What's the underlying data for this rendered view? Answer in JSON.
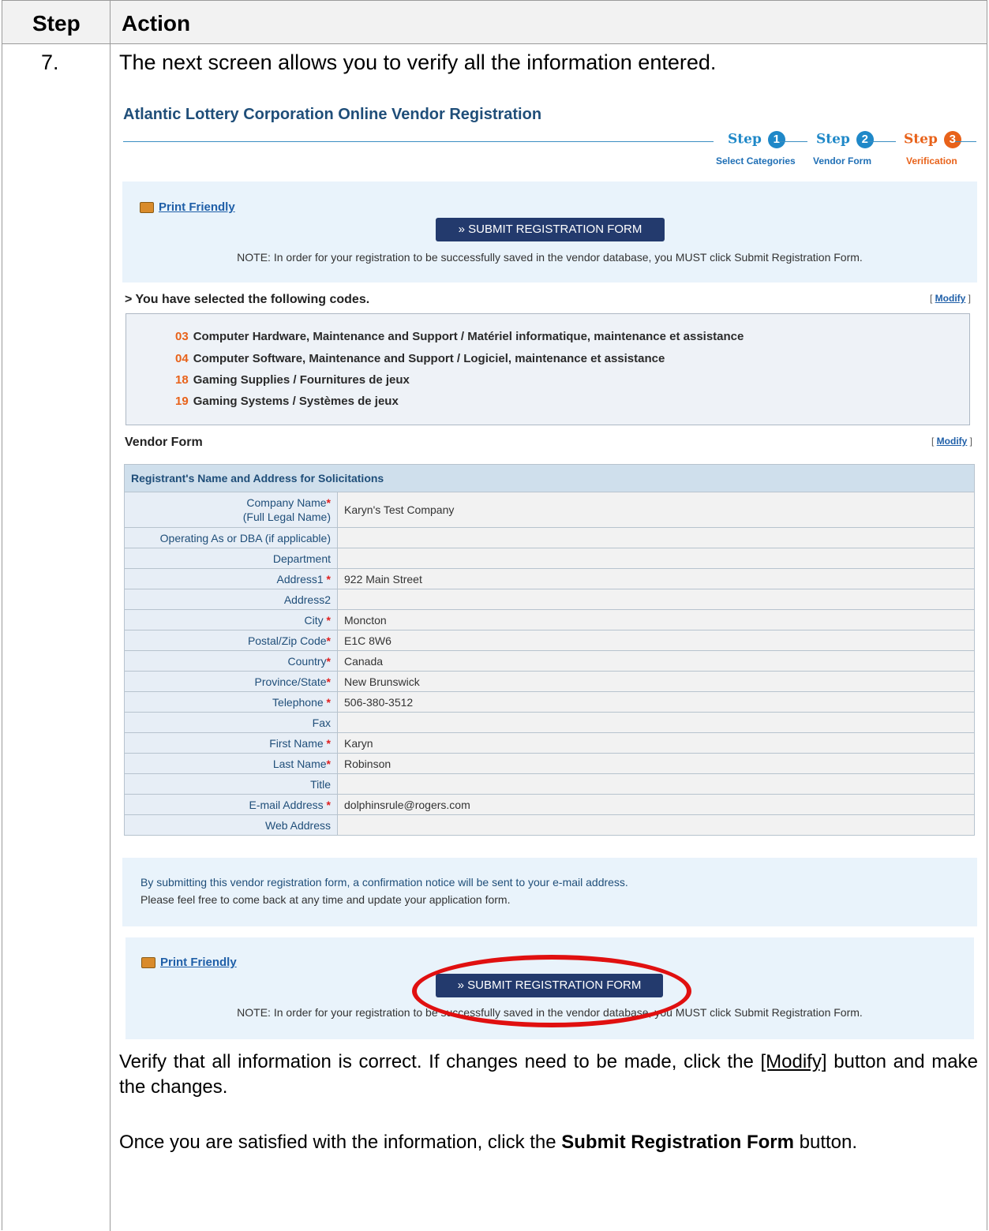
{
  "doc": {
    "col_step": "Step",
    "col_action": "Action",
    "step_number": "7.",
    "intro": "The next screen allows you to verify all the information entered.",
    "para1_a": "Verify that all information is correct. If changes need to be made, click the ",
    "para1_link": "[Modify]",
    "para1_b": " button and make the changes.",
    "para2_a": "Once you are satisfied with the information, click the ",
    "para2_bold": "Submit Registration Form",
    "para2_b": " button."
  },
  "app": {
    "title": "Atlantic Lottery Corporation Online Vendor Registration",
    "steps": [
      {
        "word": "Step",
        "num": "1",
        "label": "Select Categories"
      },
      {
        "word": "Step",
        "num": "2",
        "label": "Vendor Form"
      },
      {
        "word": "Step",
        "num": "3",
        "label": "Verification"
      }
    ],
    "print_friendly": "Print Friendly",
    "submit_button": "» SUBMIT REGISTRATION FORM",
    "note": "NOTE: In order for your registration to be successfully saved in the vendor database, you MUST click Submit Registration Form.",
    "codes_heading": "> You have selected the following codes.",
    "modify": "Modify",
    "codes": [
      {
        "num": "03",
        "text": "Computer Hardware, Maintenance and Support / Matériel informatique, maintenance et assistance"
      },
      {
        "num": "04",
        "text": "Computer Software, Maintenance and Support / Logiciel, maintenance et assistance"
      },
      {
        "num": "18",
        "text": "Gaming Supplies / Fournitures de jeux"
      },
      {
        "num": "19",
        "text": "Gaming Systems / Systèmes de jeux"
      }
    ],
    "vendor_form_heading": "Vendor Form",
    "table_title": "Registrant's Name and Address for Solicitations",
    "company_label_1": "Company Name",
    "company_label_2": "(Full Legal Name)",
    "company_value": "Karyn's Test Company",
    "rows": [
      {
        "label": "Operating As or DBA (if applicable)",
        "value": ""
      },
      {
        "label": "Department",
        "value": ""
      },
      {
        "label": "Address1",
        "value": "922 Main Street"
      },
      {
        "label": "Address2",
        "value": ""
      },
      {
        "label": "City",
        "value": "Moncton"
      },
      {
        "label": "Postal/Zip Code",
        "value": "E1C 8W6"
      },
      {
        "label": "Country",
        "value": "Canada"
      },
      {
        "label": "Province/State",
        "value": "New Brunswick"
      },
      {
        "label": "Telephone",
        "value": "506-380-3512"
      },
      {
        "label": "Fax",
        "value": ""
      },
      {
        "label": "First Name",
        "value": "Karyn"
      },
      {
        "label": "Last Name",
        "value": "Robinson"
      },
      {
        "label": "Title",
        "value": ""
      },
      {
        "label": "E-mail Address",
        "value": "dolphinsrule@rogers.com"
      },
      {
        "label": "Web Address",
        "value": ""
      }
    ],
    "required_mark": "*",
    "confirm_line1": "By submitting this vendor registration form, a confirmation notice will be sent to your e-mail address.",
    "confirm_line2": "Please feel free to come back at any time and update your application form."
  },
  "colors": {
    "accent": "#e8621a",
    "brand": "#1f4e79",
    "button": "#233a6d",
    "highlight": "#e01010"
  }
}
